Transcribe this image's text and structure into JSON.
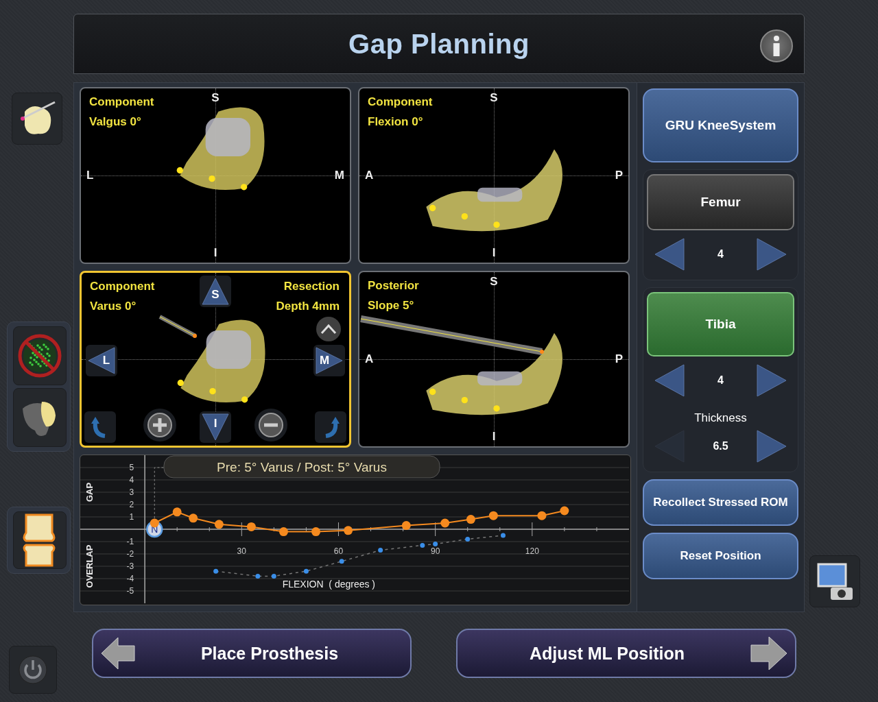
{
  "header": {
    "title": "Gap Planning"
  },
  "viewports": [
    {
      "kind": "plain",
      "selected": false,
      "labels_left": [
        "Component",
        "Valgus 0°"
      ],
      "axes": {
        "top": "S",
        "left": "L",
        "right": "M",
        "bottom": "I"
      }
    },
    {
      "kind": "plain",
      "selected": false,
      "labels_left": [
        "Component",
        "Flexion 0°"
      ],
      "axes": {
        "top": "S",
        "left": "A",
        "right": "P",
        "bottom": "I"
      }
    },
    {
      "kind": "controls",
      "selected": true,
      "labels_left": [
        "Component",
        "Varus 0°"
      ],
      "labels_right": [
        "Resection",
        "Depth 4mm"
      ],
      "axes": {
        "top": "S",
        "left": "L",
        "right": "M",
        "bottom": "I"
      }
    },
    {
      "kind": "plain",
      "selected": false,
      "labels_left": [
        "Posterior",
        "Slope 5°"
      ],
      "axes": {
        "top": "S",
        "left": "A",
        "right": "P",
        "bottom": "I"
      }
    }
  ],
  "gap_chart": {
    "marker": "N",
    "chart_data": {
      "type": "line",
      "title": "Pre: 5° Varus / Post: 5° Varus",
      "xlabel": "FLEXION  ( degrees )",
      "ylabel": [
        "GAP",
        "OVERLAP"
      ],
      "x": [
        3,
        10,
        15,
        22,
        23,
        33,
        35,
        40,
        43,
        50,
        53,
        61,
        63,
        73,
        81,
        86,
        90,
        93,
        100,
        101,
        108,
        111,
        123,
        130
      ],
      "series": [
        {
          "color": "#f58a1f",
          "marker": "circle",
          "line_style": "solid",
          "values": [
            0.5,
            1.4,
            0.9,
            null,
            0.4,
            0.2,
            null,
            null,
            -0.2,
            null,
            -0.2,
            null,
            -0.1,
            null,
            0.3,
            null,
            null,
            0.5,
            null,
            0.8,
            1.1,
            null,
            1.1,
            1.5
          ]
        },
        {
          "color": "#3a8ee8",
          "marker": "circle",
          "line_style": "dashed",
          "values": [
            null,
            null,
            null,
            -3.4,
            null,
            null,
            -3.8,
            -3.8,
            null,
            -3.4,
            null,
            -2.6,
            null,
            -1.7,
            null,
            -1.3,
            -1.2,
            null,
            -0.8,
            null,
            null,
            -0.5,
            null,
            null
          ]
        }
      ],
      "grid": true,
      "xlim": [
        -20,
        150
      ],
      "ylim": [
        -6,
        6
      ],
      "xticks": [
        30,
        60,
        90,
        120
      ],
      "yticks": [
        -5,
        -4,
        -3,
        -2,
        -1,
        1,
        2,
        3,
        4,
        5
      ]
    }
  },
  "side_panel": {
    "system_button": "GRU KneeSystem",
    "components": [
      {
        "label": "Femur",
        "selected": false,
        "steppers": [
          {
            "value": "4",
            "prev_disabled": false
          }
        ]
      },
      {
        "label": "Tibia",
        "selected": true,
        "steppers": [
          {
            "value": "4",
            "prev_disabled": false
          },
          {
            "label": "Thickness",
            "value": "6.5",
            "prev_disabled": true
          }
        ]
      }
    ],
    "buttons": [
      "Recollect Stressed ROM",
      "Reset Position"
    ]
  },
  "navigation": {
    "back": "Place Prosthesis",
    "next": "Adjust ML Position"
  }
}
